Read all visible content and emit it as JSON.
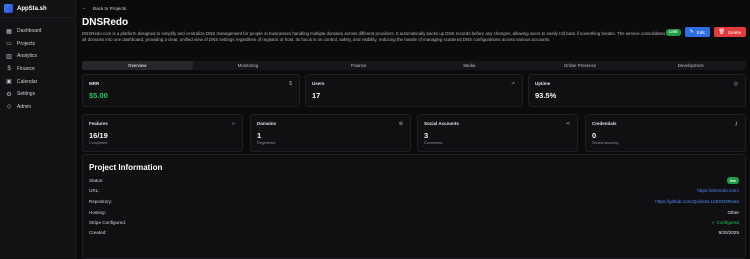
{
  "app": {
    "name": "AppSta.sh"
  },
  "sidebar": {
    "items": [
      {
        "label": "Dashboard",
        "icon": "grid-icon"
      },
      {
        "label": "Projects",
        "icon": "folder-icon"
      },
      {
        "label": "Analytics",
        "icon": "bar-chart-icon"
      },
      {
        "label": "Finance",
        "icon": "dollar-icon"
      },
      {
        "label": "Calendar",
        "icon": "calendar-icon"
      },
      {
        "label": "Settings",
        "icon": "gear-icon"
      },
      {
        "label": "Admin",
        "icon": "shield-icon"
      }
    ]
  },
  "header": {
    "back_label": "Back to Projects",
    "title": "DNSRedo",
    "description": "DNSRedo.com is a platform designed to simplify and centralize DNS management for people or businesses handling multiple domains across different providers. It automatically backs up DNS records before any changes, allowing users to easily roll back if something breaks. The service consolidates all domains into one dashboard, providing a clear, unified view of DNS settings regardless of registrar or host. Its focus is on control, safety, and visibility, reducing the hassle of managing scattered DNS configurations across various accounts.",
    "status_badge": "LIVE",
    "edit_label": "Edit",
    "delete_label": "Delete"
  },
  "tabs": [
    "Overview",
    "Monitoring",
    "Finance",
    "Media",
    "Online Presence",
    "Development"
  ],
  "active_tab": "Overview",
  "stats": {
    "mrr": {
      "label": "MRR",
      "value": "$5.00",
      "icon": "dollar-icon"
    },
    "users": {
      "label": "Users",
      "value": "17",
      "icon": "trend-up-icon"
    },
    "uptime": {
      "label": "Uptime",
      "value": "93.5%",
      "icon": "activity-icon"
    },
    "features": {
      "label": "Features",
      "value": "16/19",
      "sub": "Completed",
      "icon": "code-icon"
    },
    "domains": {
      "label": "Domains",
      "value": "1",
      "sub": "Registered",
      "icon": "globe-icon"
    },
    "social": {
      "label": "Social Accounts",
      "value": "3",
      "sub": "Connected",
      "icon": "share-icon"
    },
    "credentials": {
      "label": "Credentials",
      "value": "0",
      "sub": "Stored securely",
      "icon": "key-icon"
    }
  },
  "project_info": {
    "title": "Project Information",
    "rows": [
      {
        "label": "Status:",
        "value": "live"
      },
      {
        "label": "URL:",
        "value": "https://dnsredo.com/"
      },
      {
        "label": "Repository:",
        "value": "https://github.com/QuickieLLM/DNSRedo"
      },
      {
        "label": "Hosting:",
        "value": "Other"
      },
      {
        "label": "Stripe Configured:",
        "value": "✓ Configured"
      },
      {
        "label": "Created:",
        "value": "9/30/2025"
      }
    ]
  },
  "colors": {
    "accent": "#2f6fe4",
    "success": "#22c55e",
    "danger": "#e23b3b",
    "background": "#0b0b0c"
  }
}
